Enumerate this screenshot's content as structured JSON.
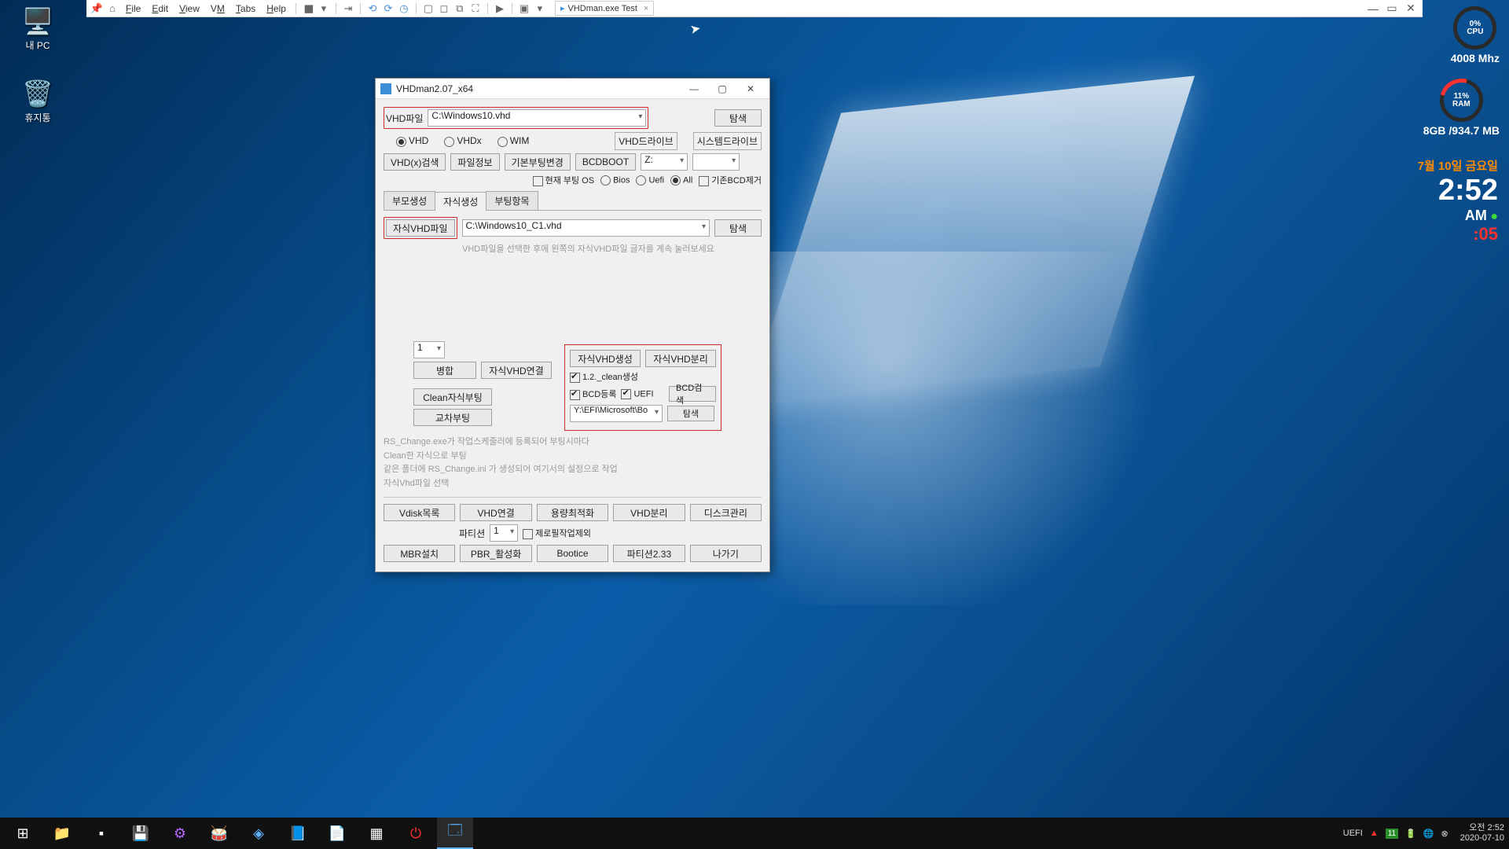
{
  "desktop": {
    "my_pc": "내 PC",
    "recycle_bin": "휴지통"
  },
  "vm_toolbar": {
    "menus": [
      "File",
      "Edit",
      "View",
      "VM",
      "Tabs",
      "Help"
    ],
    "tab_title": "VHDman.exe Test"
  },
  "hud": {
    "cpu_pct": "0%",
    "cpu_lbl": "CPU",
    "cpu_freq": "4008 Mhz",
    "ram_pct": "11%",
    "ram_lbl": "RAM",
    "ram_usage": "8GB /934.7 MB",
    "date": "7월 10일 금요일",
    "time": "2:52",
    "ampm": "AM",
    "sec": ":05"
  },
  "app": {
    "title": "VHDman2.07_x64",
    "vhd_file_lbl": "VHD파일",
    "vhd_file_value": "C:\\Windows10.vhd",
    "browse": "탐색",
    "radio_vhd": "VHD",
    "radio_vhdx": "VHDx",
    "radio_wim": "WIM",
    "vhd_drive_lbl": "VHD드라이브",
    "sys_drive_lbl": "시스템드라이브",
    "btn_vhd_search": "VHD(x)검색",
    "btn_file_info": "파일정보",
    "btn_boot_change": "기본부팅변경",
    "btn_bcdboot": "BCDBOOT",
    "drive_value": "Z:",
    "chk_current_os": "현재 부팅 OS",
    "radio_bios": "Bios",
    "radio_uefi": "Uefi",
    "radio_all": "All",
    "chk_remove_bcd": "기존BCD제거",
    "tabs": [
      "부모생성",
      "자식생성",
      "부팅항목"
    ],
    "child_btn": "자식VHD파일",
    "child_file": "C:\\Windows10_C1.vhd",
    "child_browse": "탐색",
    "child_hint": "VHD파일을 선택한 후에 왼쪽의 자식VHD파일 글자를 계속 눌러보세요",
    "count_value": "1",
    "btn_merge": "병합",
    "btn_child_connect": "자식VHD연결",
    "btn_child_create": "자식VHD생성",
    "btn_child_detach": "자식VHD분리",
    "chk_clean": "1.2._clean생성",
    "chk_bcd_reg": "BCD등록",
    "chk_uefi": "UEFI",
    "btn_bcd_search": "BCD검색",
    "efi_path": "Y:\\EFI\\Microsoft\\Bo",
    "btn_browse2": "탐색",
    "btn_clean_boot": "Clean자식부팅",
    "btn_cross_boot": "교차부팅",
    "info1": "RS_Change.exe가 작업스케줄러에 등록되어 부팅시마다",
    "info2": "Clean한 자식으로 부팅",
    "info3": "같은 폴더에 RS_Change.ini 가 생성되어 여기서의 설정으로 작업",
    "info4": "자식Vhd파일 선택",
    "footer": {
      "vdisk_list": "Vdisk목록",
      "vhd_connect": "VHD연결",
      "size_opt": "용량최적화",
      "vhd_detach": "VHD분리",
      "disk_mgmt": "디스크관리",
      "partition_lbl": "파티션",
      "partition_val": "1",
      "chk_zerofill": "제로필작업제외",
      "mbr": "MBR설치",
      "pbr": "PBR_활성화",
      "bootice": "Bootice",
      "partition233": "파티션2.33",
      "exit": "나가기"
    }
  },
  "taskbar": {
    "uefi": "UEFI",
    "badge": "11",
    "time": "오전 2:52",
    "date": "2020-07-10"
  }
}
